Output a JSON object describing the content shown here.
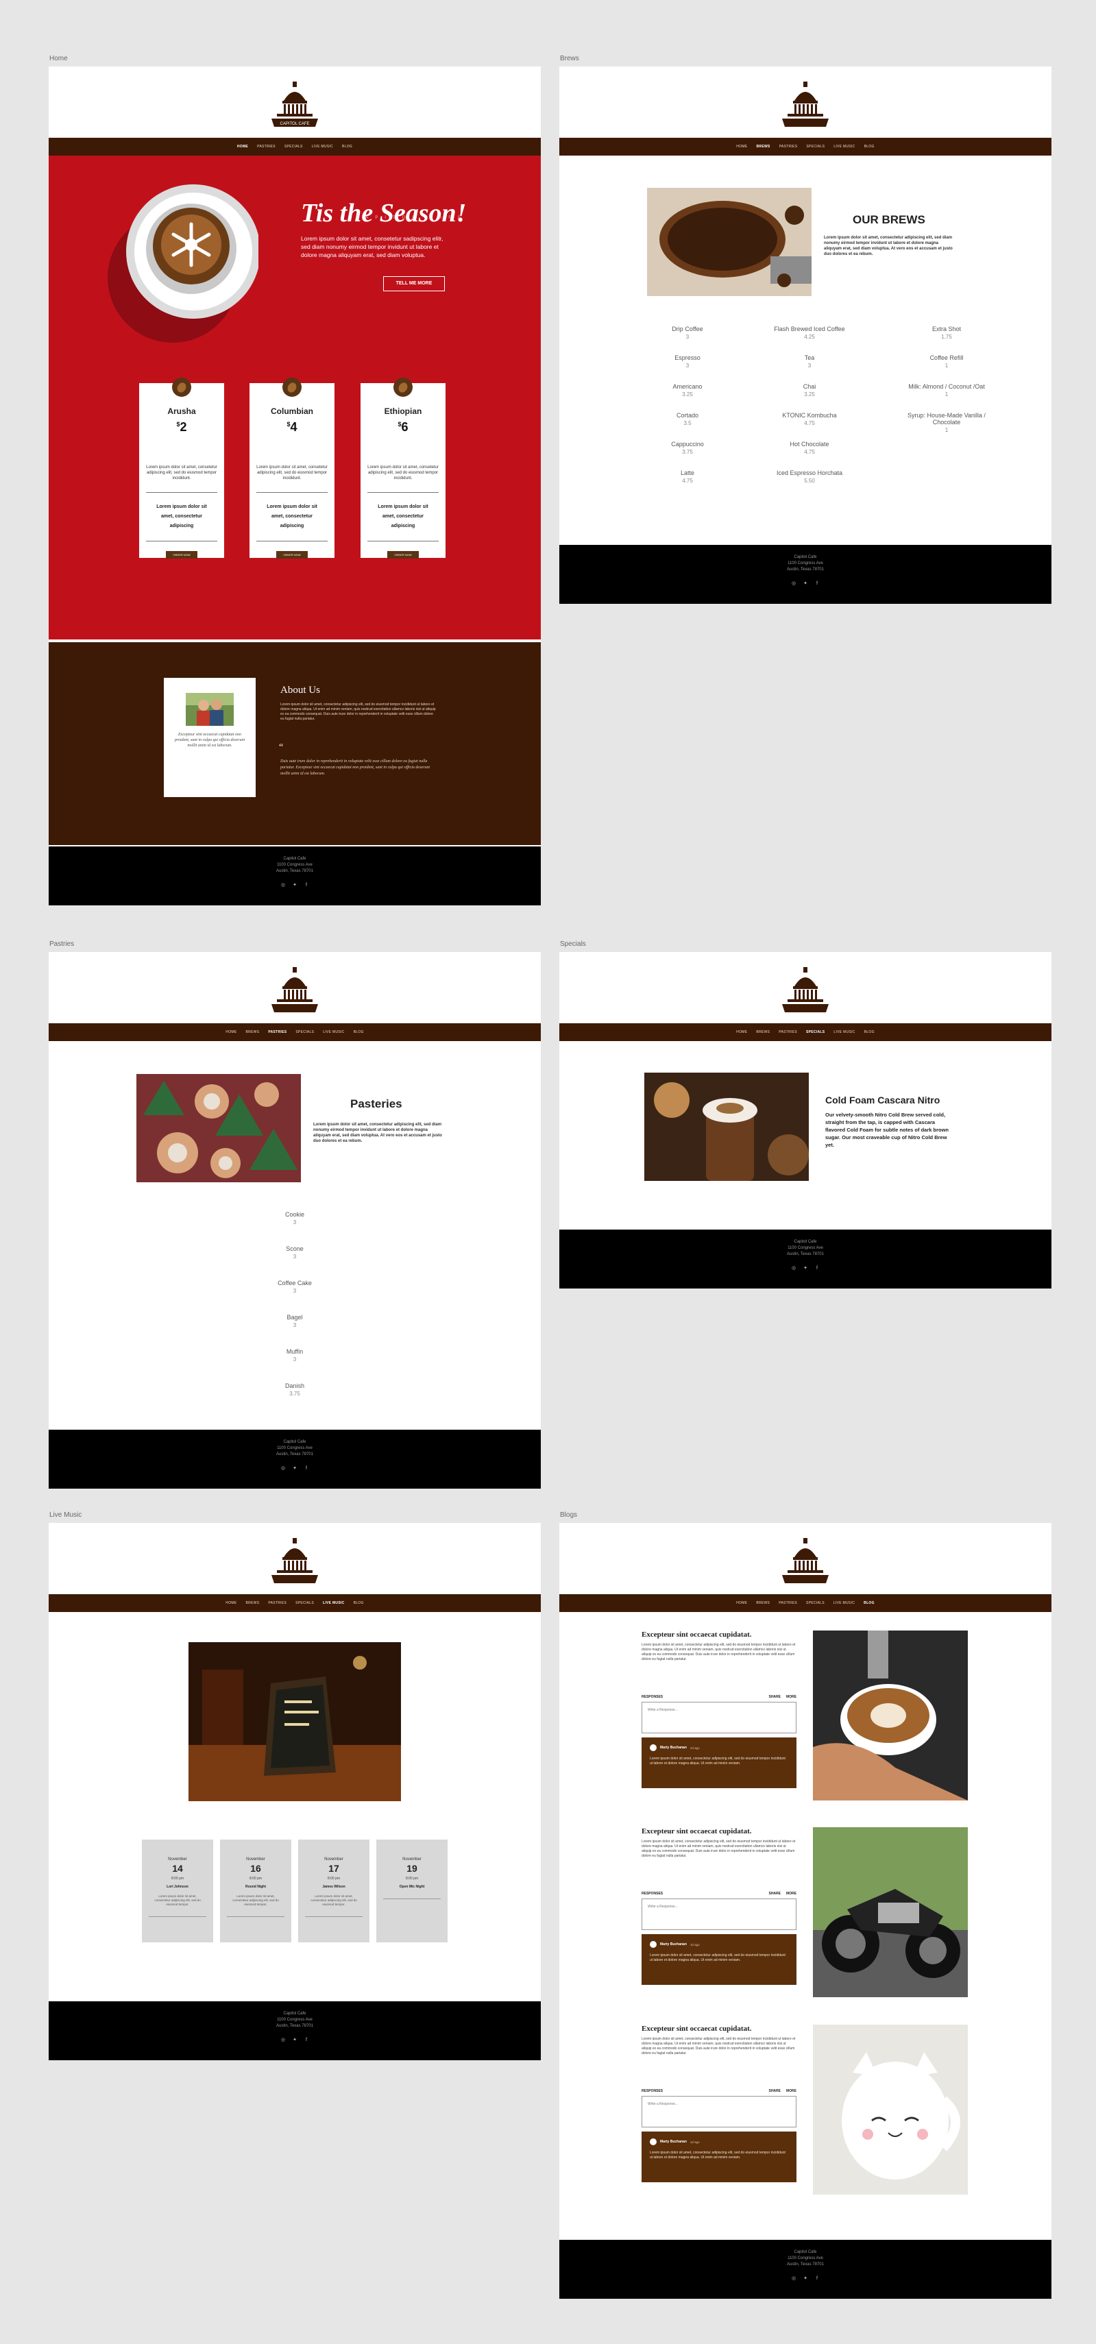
{
  "labels": {
    "home": "Home",
    "brews": "Brews",
    "pastries": "Pastries",
    "specials": "Specials",
    "live": "Live Music",
    "blogs": "Blogs"
  },
  "logo_text": "CAPITOL CAFE",
  "nav_home": [
    "HOME",
    "PASTRIES",
    "SPECIALS",
    "LIVE MUSIC",
    "BLOG"
  ],
  "nav_a": [
    "HOME",
    "BREWS",
    "PASTRIES",
    "SPECIALS",
    "LIVE MUSIC",
    "BLOG"
  ],
  "nav_b": [
    "HOME",
    "BREWS",
    "PASTRIES",
    "SPECIALS",
    "LIVE MUSIC",
    "BLOG"
  ],
  "nav_blog": [
    "HOME",
    "BREWS",
    "PASTRIES",
    "SPECIALS",
    "LIVE MUSIC",
    "BLOG"
  ],
  "footer": {
    "line1": "Capitol Cafe",
    "line2": "1100 Congress Ave",
    "line3": "Austin, Texas 78701"
  },
  "hero": {
    "title": "Tis the Season!",
    "subtitle": "CAPITOL CAFE",
    "body": "Lorem ipsum dolor sit amet, consetetur sadipscing elitr, sed diam nonumy eirmod tempor invidunt ut labore et dolore magna aliquyam erat, sed diam voluptua.",
    "button": "TELL ME MORE"
  },
  "coffees": [
    {
      "name": "Arusha",
      "price": "2",
      "desc": "Lorem ipsum dolor sit amet, consetetur adipiscing elit, sed do eiusmod tempor incididunt.",
      "bold": "Lorem ipsum dolor sit amet, consectetur adipiscing",
      "btn": "ORDER NOW"
    },
    {
      "name": "Columbian",
      "price": "4",
      "desc": "Lorem ipsum dolor sit amet, consetetur adipiscing elit, sed do eiusmod tempor incididunt.",
      "bold": "Lorem ipsum dolor sit amet, consectetur adipiscing",
      "btn": "ORDER NOW"
    },
    {
      "name": "Ethiopian",
      "price": "6",
      "desc": "Lorem ipsum dolor sit amet, consetetur adipiscing elit, sed do eiusmod tempor incididunt.",
      "bold": "Lorem ipsum dolor sit amet, consectetur adipiscing",
      "btn": "ORDER NOW"
    }
  ],
  "about": {
    "title": "About Us",
    "caption": "Excepteur sint occaecat cupidatat non proident, sunt in culpa qui officia deserunt mollit anim id est laborum.",
    "body": "Lorem ipsum dolor sit amet, consectetur adipiscing elit, sed do eiusmod tempor incididunt ut labore et dolore magna aliqua. Ut enim ad minim veniam, quis nostrud exercitation ullamco laboris nisi ut aliquip ex ea commodo consequat. Duis aute irure dolor in reprehenderit in voluptate velit esse cillum dolore eu fugiat nulla pariatur.",
    "quote_mark": "“",
    "quote": "Duis aute irure dolor in reprehenderit in voluptate velit esse cillum dolore eu fugiat nulla pariatur. Excepteur sint occaecat cupidatat non proident, sunt in culpa qui officia deserunt mollit anim id est laborum."
  },
  "brews": {
    "title": "OUR BREWS",
    "body": "Lorem ipsum dolor sit amet, consectetur adipiscing elit, sed diam nonumy eirmod tempor invidunt ut labore et dolore magna aliquyam erat, sed diam voluptua. At vero eos et accusam et justo duo dolores et ea rebum.",
    "col1": [
      {
        "n": "Drip Coffee",
        "p": "3"
      },
      {
        "n": "Espresso",
        "p": "3"
      },
      {
        "n": "Americano",
        "p": "3.25"
      },
      {
        "n": "Cortado",
        "p": "3.5"
      },
      {
        "n": "Cappuccino",
        "p": "3.75"
      },
      {
        "n": "Latte",
        "p": "4.75"
      }
    ],
    "col2": [
      {
        "n": "Flash Brewed Iced Coffee",
        "p": "4.25"
      },
      {
        "n": "Tea",
        "p": "3"
      },
      {
        "n": "Chai",
        "p": "3.25"
      },
      {
        "n": "KTONIC Kombucha",
        "p": "4.75"
      },
      {
        "n": "Hot Chocolate",
        "p": "4.75"
      },
      {
        "n": "Iced Espresso Horchata",
        "p": "5.50"
      }
    ],
    "col3": [
      {
        "n": "Extra Shot",
        "p": "1.75"
      },
      {
        "n": "Coffee Refill",
        "p": "1"
      },
      {
        "n": "Milk: Almond / Coconut /Oat",
        "p": "1"
      },
      {
        "n": "Syrup: House-Made Vanilla / Chocolate",
        "p": "1"
      }
    ]
  },
  "pastries": {
    "title": "Pasteries",
    "body": "Lorem ipsum dolor sit amet, consectetur adipiscing elit, sed diam nonumy eirmod tempor invidunt ut labore et dolore magna aliquyam erat, sed diam voluptua. At vero eos et accusam et justo duo dolores et ea rebum.",
    "items": [
      {
        "n": "Cookie",
        "p": "3"
      },
      {
        "n": "Scone",
        "p": "3"
      },
      {
        "n": "Coffee Cake",
        "p": "3"
      },
      {
        "n": "Bagel",
        "p": "3"
      },
      {
        "n": "Muffin",
        "p": "3"
      },
      {
        "n": "Danish",
        "p": "3.75"
      }
    ]
  },
  "specials": {
    "title": "Cold Foam Cascara Nitro",
    "body": "Our velvety-smooth Nitro Cold Brew served cold, straight from the tap, is capped with Cascara flavored Cold Foam for subtle notes of dark brown sugar. Our most craveable cup of Nitro Cold Brew yet."
  },
  "events": [
    {
      "month": "November",
      "day": "14",
      "time": "8:00 pm",
      "act": "Lori Johnson",
      "desc": "Lorem ipsum dolor sit amet, consectetur adipiscing elit, sed do eiusmod tempor."
    },
    {
      "month": "November",
      "day": "16",
      "time": "8:00 pm",
      "act": "Round Night",
      "desc": "Lorem ipsum dolor sit amet, consectetur adipiscing elit, sed do eiusmod tempor."
    },
    {
      "month": "November",
      "day": "17",
      "time": "8:00 pm",
      "act": "James Wilson",
      "desc": "Lorem ipsum dolor sit amet, consectetur adipiscing elit, sed do eiusmod tempor."
    },
    {
      "month": "November",
      "day": "19",
      "time": "8:00 pm",
      "act": "Open Mic Night",
      "desc": ""
    }
  ],
  "blog": {
    "title": "Excepteur sint occaecat cupidatat.",
    "body": "Lorem ipsum dolor sit amet, consectetur adipiscing elit, sed do eiusmod tempor incididunt ut labore et dolore magna aliqua. Ut enim ad minim veniam, quis nostrud exercitation ullamco laboris nisi ut aliquip ex ea commodo consequat. Duis aute irure dolor in reprehenderit in voluptate velit esse cillum dolore eu fugiat nulla pariatur.",
    "responses": "RESPONSES",
    "share": "SHARE",
    "more": "MORE",
    "placeholder": "Write a Response...",
    "commenter": "Marty Buchanan",
    "ago": "1d ago",
    "comment": "Lorem ipsum dolor sit amet, consectetur adipiscing elit, sed do eiusmod tempor incididunt ut labore et dolore magna aliqua. Ut enim ad minim veniam."
  }
}
